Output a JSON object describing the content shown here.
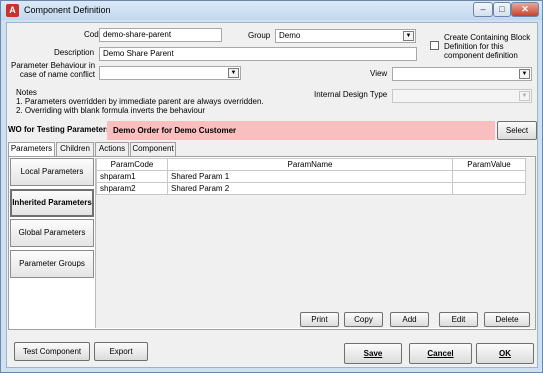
{
  "window": {
    "title": "Component Definition",
    "app_icon": "A"
  },
  "form": {
    "code_label": "Code",
    "code_value": "demo-share-parent",
    "group_label": "Group",
    "group_value": "Demo",
    "create_block_label_1": "Create Containing Block",
    "create_block_label_2": "Definition for this",
    "create_block_label_3": "component definition",
    "description_label": "Description",
    "description_value": "Demo Share Parent",
    "param_behaviour_label_1": "Parameter Behaviour in",
    "param_behaviour_label_2": "case of name conflict",
    "param_behaviour_value": "",
    "view_label": "View",
    "view_value": "",
    "notes_label": "Notes",
    "notes_line1": "1. Parameters overridden by immediate parent are always overridden.",
    "notes_line2": "2. Overriding with blank formula inverts the behaviour",
    "internal_design_type_label": "Internal Design Type",
    "internal_design_type_value": ""
  },
  "wo": {
    "label": "WO for Testing Parameters:",
    "value": "Demo Order for Demo Customer",
    "select_button": "Select"
  },
  "tabs": [
    "Parameters",
    "Children",
    "Actions",
    "Component"
  ],
  "side_buttons": [
    "Local Parameters",
    "Inherited Parameters",
    "Global Parameters",
    "Parameter Groups"
  ],
  "grid": {
    "headers": [
      "ParamCode",
      "ParamName",
      "ParamValue"
    ],
    "rows": [
      [
        "shparam1",
        "Shared Param 1",
        ""
      ],
      [
        "shparam2",
        "Shared Param 2",
        ""
      ]
    ]
  },
  "grid_buttons": [
    "Print",
    "Copy",
    "Add",
    "Edit",
    "Delete"
  ],
  "footer": {
    "test_component": "Test Component",
    "export": "Export",
    "save": "Save",
    "cancel": "Cancel",
    "ok": "OK"
  },
  "colors": {
    "wo_highlight": "#f9bebe",
    "window_frame": "#cfe0f1",
    "close_button": "#c6422c"
  }
}
